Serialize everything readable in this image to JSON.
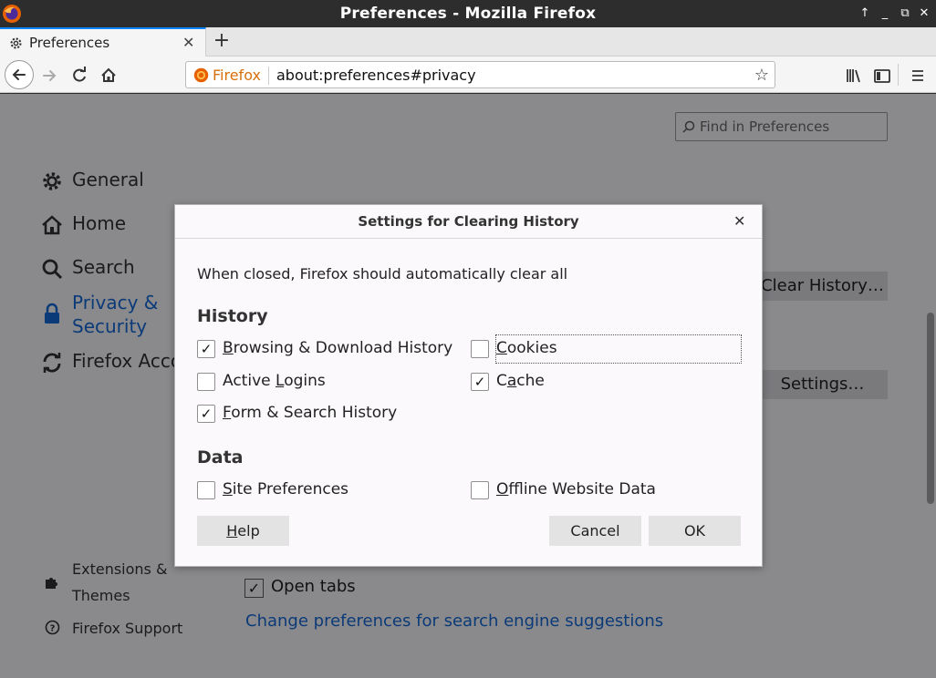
{
  "window": {
    "title": "Preferences - Mozilla Firefox"
  },
  "tab": {
    "title": "Preferences"
  },
  "urlbar": {
    "identity": "Firefox",
    "url": "about:preferences#privacy"
  },
  "find": {
    "placeholder": "Find in Preferences"
  },
  "sidebar": {
    "general": "General",
    "home": "Home",
    "search": "Search",
    "privacy_line1": "Privacy &",
    "privacy_line2": "Security",
    "account": "Firefox Acco",
    "extensions_line1": "Extensions &",
    "extensions_line2": "Themes",
    "support": "Firefox Support"
  },
  "background": {
    "clear_history_btn": "Clear History…",
    "settings_btn": "Settings…",
    "open_tabs": "Open tabs",
    "search_suggestions_link": "Change preferences for search engine suggestions"
  },
  "dialog": {
    "title": "Settings for Clearing History",
    "description": "When closed, Firefox should automatically clear all",
    "history_heading": "History",
    "data_heading": "Data",
    "options": {
      "browsing": {
        "label_u": "B",
        "label_rest": "rowsing & Download History",
        "checked": true
      },
      "cookies": {
        "label_u": "C",
        "label_rest": "ookies",
        "checked": false
      },
      "logins": {
        "label_pre": "Active ",
        "label_u": "L",
        "label_rest": "ogins",
        "checked": false
      },
      "cache": {
        "label_pre": "C",
        "label_u": "a",
        "label_rest": "che",
        "checked": true
      },
      "forms": {
        "label_u": "F",
        "label_rest": "orm & Search History",
        "checked": true
      },
      "site_prefs": {
        "label_u": "S",
        "label_rest": "ite Preferences",
        "checked": false
      },
      "offline": {
        "label_u": "O",
        "label_rest": "ffline Website Data",
        "checked": false
      }
    },
    "help_u": "H",
    "help_rest": "elp",
    "cancel": "Cancel",
    "ok": "OK"
  },
  "colors": {
    "accent": "#0a84ff",
    "link": "#0b3a78",
    "identity": "#d7700c"
  }
}
